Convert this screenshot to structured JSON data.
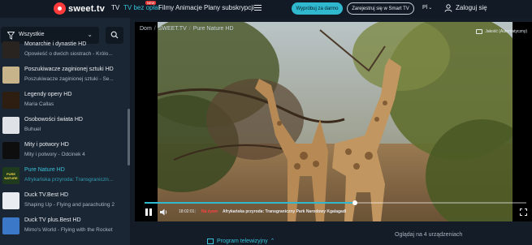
{
  "nav": {
    "logo_text": "sweet.tv",
    "items": [
      "TV",
      "TV bez opłat",
      "Filmy",
      "Animacje",
      "Plany subskrypcji"
    ],
    "new_badge": "NEW",
    "trial_button": "Wypróbuj za darmo",
    "smarttv_button": "Zarejestruj się w Smart TV",
    "language": "Pl",
    "login": "Zaloguj się"
  },
  "sidebar": {
    "filter_label": "Wszystkie",
    "channels": [
      {
        "title": "Monarchie i dynastie HD",
        "subtitle": "Opowieść o dwóch siostrach - Królo...",
        "thumb_color": "#2a2420",
        "thumb_text": ""
      },
      {
        "title": "Poszukiwacze zaginionej sztuki HD",
        "subtitle": "Poszukiwacze zaginionej sztuki - Se...",
        "thumb_color": "#c8b48a",
        "thumb_text": ""
      },
      {
        "title": "Legendy opery HD",
        "subtitle": "Maria Callas",
        "thumb_color": "#2e1e12",
        "thumb_text": ""
      },
      {
        "title": "Osobowości świata HD",
        "subtitle": "Buhuel",
        "thumb_color": "#dfe3e8",
        "thumb_text": ""
      },
      {
        "title": "Mity i potwory HD",
        "subtitle": "Mity i potwory - Odcinek 4",
        "thumb_color": "#0e0e0e",
        "thumb_text": ""
      },
      {
        "title": "Pure Nature HD",
        "subtitle": "Afrykańska przyroda: Transgraniczn...",
        "thumb_color": "#1f3a1c",
        "thumb_text": "PURE NATURE"
      },
      {
        "title": "Duck TV.Best HD",
        "subtitle": "Shaping Up - Flying and parachuting 2",
        "thumb_color": "#e9edf2",
        "thumb_text": ""
      },
      {
        "title": "Duck TV plus.Best HD",
        "subtitle": "Mimo's World - Flying with the Rocket",
        "thumb_color": "#3b78c8",
        "thumb_text": ""
      }
    ],
    "active_index": 5
  },
  "player": {
    "breadcrumb": [
      "Dom",
      "SWEET.TV",
      "Pure Nature HD"
    ],
    "quality": "Jakość (Automatyczny)",
    "progress": 0.55,
    "time_now": "18:02:01",
    "time_sep": "|",
    "live_label": "Na żywo",
    "program_title": "Afrykańska przyroda: Transgraniczny Park Narodowy Kgalagadi"
  },
  "bottom": {
    "tv_program": "Program telewizyjny",
    "watch_count": "Oglądaj na 4 urządzeniach"
  },
  "colors": {
    "accent": "#30b8cf",
    "background": "#141c27",
    "sidebar": "#1b2634",
    "live": "#ff4040"
  }
}
